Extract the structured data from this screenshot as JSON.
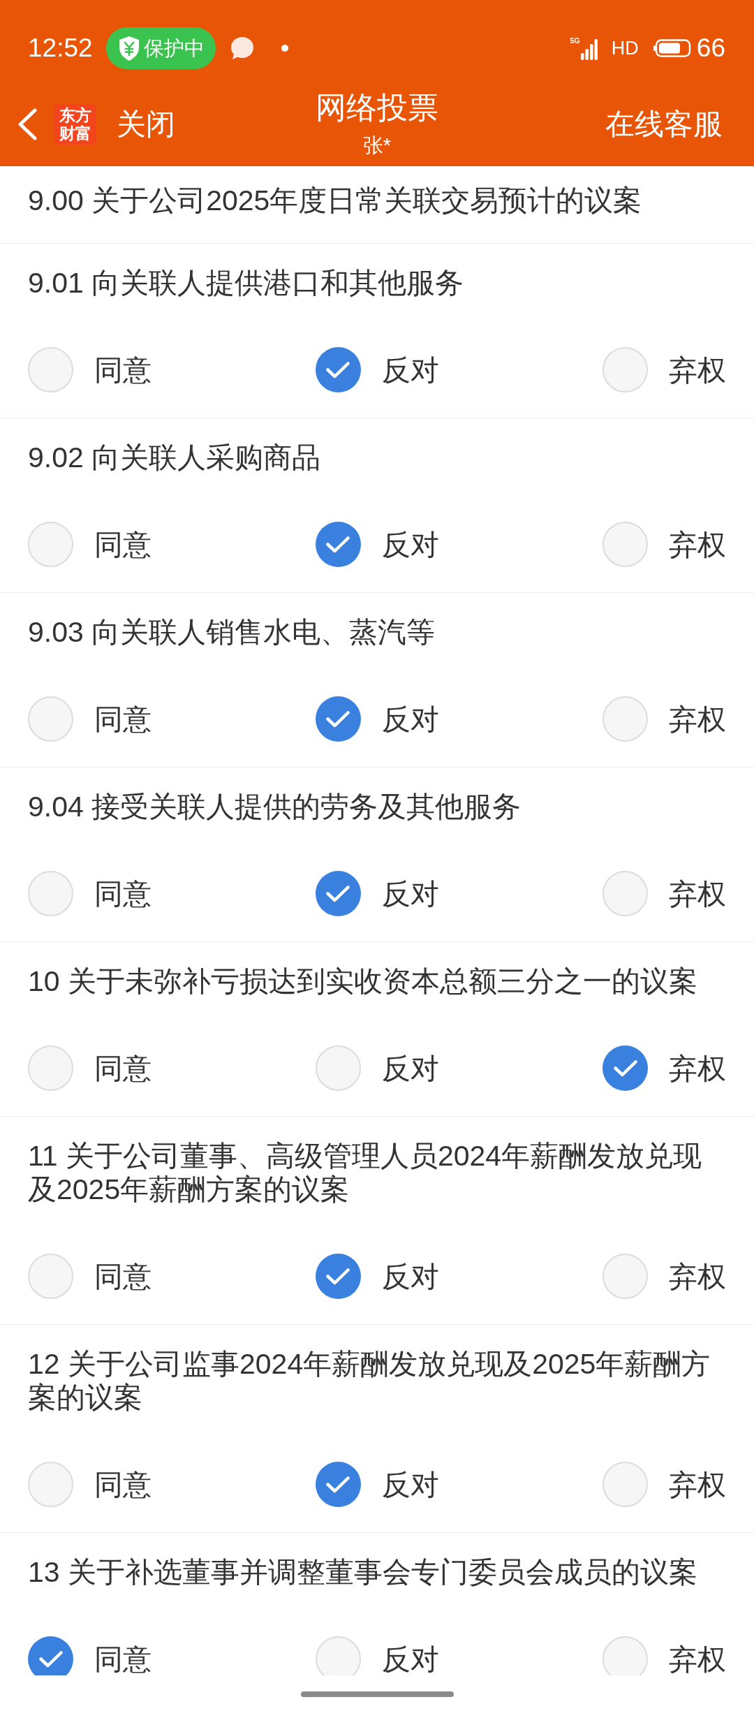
{
  "status_bar": {
    "time": "12:52",
    "protection_badge": "保护中",
    "network": "5G",
    "hd": "HD",
    "battery": "66"
  },
  "nav": {
    "logo": "东方财富",
    "close": "关闭",
    "title": "网络投票",
    "subtitle": "张*",
    "service": "在线客服"
  },
  "proposals": [
    {
      "kind": "group",
      "title": "9.00 关于公司2025年度日常关联交易预计的议案"
    },
    {
      "kind": "vote",
      "title": "9.01 向关联人提供港口和其他服务",
      "options": [
        {
          "label": "同意",
          "selected": false
        },
        {
          "label": "反对",
          "selected": true
        },
        {
          "label": "弃权",
          "selected": false
        }
      ]
    },
    {
      "kind": "vote",
      "title": "9.02 向关联人采购商品",
      "options": [
        {
          "label": "同意",
          "selected": false
        },
        {
          "label": "反对",
          "selected": true
        },
        {
          "label": "弃权",
          "selected": false
        }
      ]
    },
    {
      "kind": "vote",
      "title": "9.03 向关联人销售水电、蒸汽等",
      "options": [
        {
          "label": "同意",
          "selected": false
        },
        {
          "label": "反对",
          "selected": true
        },
        {
          "label": "弃权",
          "selected": false
        }
      ]
    },
    {
      "kind": "vote",
      "title": "9.04 接受关联人提供的劳务及其他服务",
      "options": [
        {
          "label": "同意",
          "selected": false
        },
        {
          "label": "反对",
          "selected": true
        },
        {
          "label": "弃权",
          "selected": false
        }
      ]
    },
    {
      "kind": "vote",
      "title": "10 关于未弥补亏损达到实收资本总额三分之一的议案",
      "options": [
        {
          "label": "同意",
          "selected": false
        },
        {
          "label": "反对",
          "selected": false
        },
        {
          "label": "弃权",
          "selected": true
        }
      ]
    },
    {
      "kind": "vote",
      "title": "11 关于公司董事、高级管理人员2024年薪酬发放兑现及2025年薪酬方案的议案",
      "options": [
        {
          "label": "同意",
          "selected": false
        },
        {
          "label": "反对",
          "selected": true
        },
        {
          "label": "弃权",
          "selected": false
        }
      ]
    },
    {
      "kind": "vote",
      "title": "12 关于公司监事2024年薪酬发放兑现及2025年薪酬方案的议案",
      "options": [
        {
          "label": "同意",
          "selected": false
        },
        {
          "label": "反对",
          "selected": true
        },
        {
          "label": "弃权",
          "selected": false
        }
      ]
    },
    {
      "kind": "vote",
      "title": "13 关于补选董事并调整董事会专门委员会成员的议案",
      "options": [
        {
          "label": "同意",
          "selected": true
        },
        {
          "label": "反对",
          "selected": false
        },
        {
          "label": "弃权",
          "selected": false
        }
      ]
    }
  ]
}
